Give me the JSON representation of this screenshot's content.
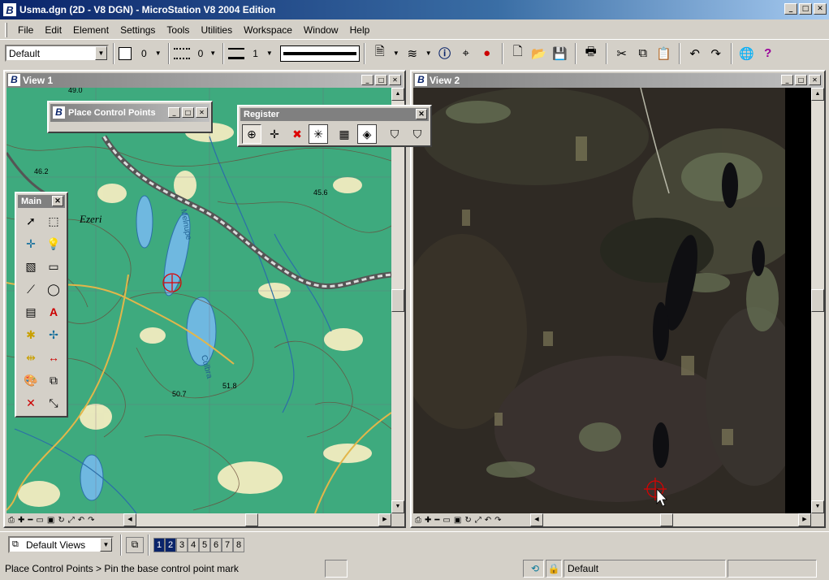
{
  "app": {
    "title": "Usma.dgn (2D - V8 DGN) - MicroStation V8 2004 Edition",
    "logo_letter": "B"
  },
  "menu": {
    "items": [
      "File",
      "Edit",
      "Element",
      "Settings",
      "Tools",
      "Utilities",
      "Workspace",
      "Window",
      "Help"
    ]
  },
  "toolbar": {
    "level": "Default",
    "color_value": "0",
    "style_value": "0",
    "weight_value": "1"
  },
  "view1": {
    "title": "View 1",
    "map_labels": {
      "elev_49": "49.0",
      "elev_46": "46.2",
      "elev_45": "45.6",
      "elev_51": "51.8",
      "elev_50": "50.7",
      "ezeri": "Ezeri",
      "lake": "Culbra",
      "river": "Melnupe"
    }
  },
  "view2": {
    "title": "View 2"
  },
  "place_control_points": {
    "title": "Place Control Points"
  },
  "register": {
    "title": "Register"
  },
  "main_palette": {
    "title": "Main"
  },
  "bottom": {
    "views_combo": "Default Views",
    "view_numbers": [
      "1",
      "2",
      "3",
      "4",
      "5",
      "6",
      "7",
      "8"
    ],
    "active_views": [
      "1",
      "2"
    ]
  },
  "status": {
    "prompt": "Place Control Points > Pin the base control point mark",
    "active_level": "Default"
  },
  "colors": {
    "title_active": "#0a246a",
    "map_green": "#3eaa7e",
    "chrome": "#d4d0c8"
  }
}
